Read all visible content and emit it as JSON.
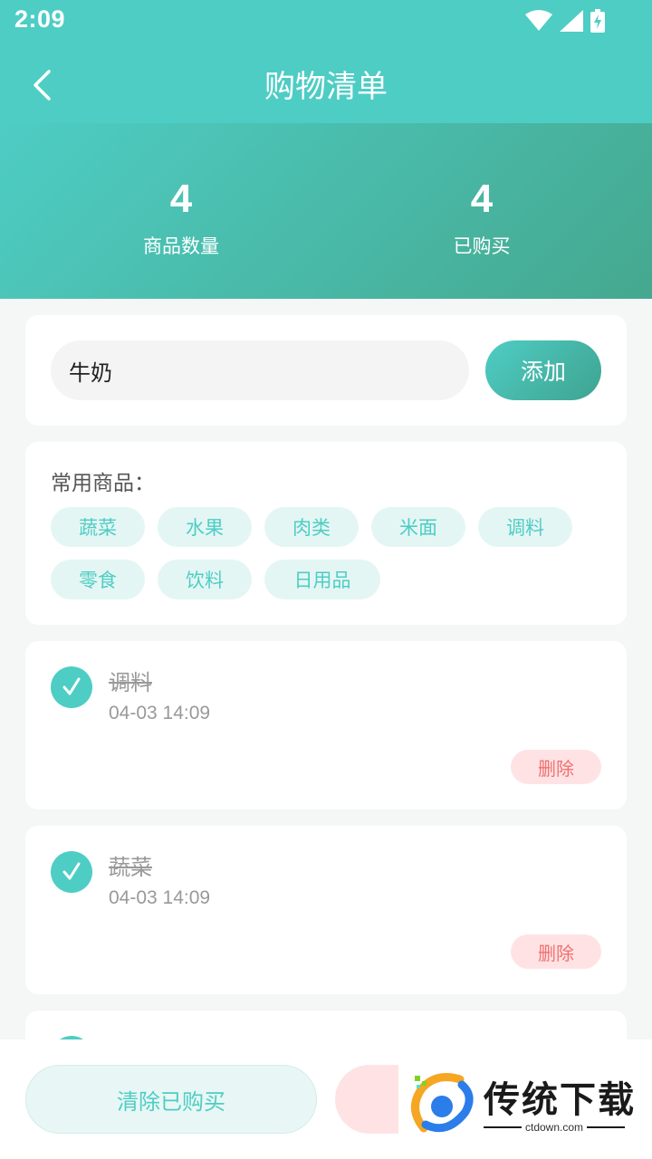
{
  "status": {
    "time": "2:09"
  },
  "nav": {
    "title": "购物清单"
  },
  "stats": [
    {
      "value": "4",
      "label": "商品数量"
    },
    {
      "value": "4",
      "label": "已购买"
    }
  ],
  "input": {
    "value": "牛奶",
    "add_label": "添加"
  },
  "common": {
    "title": "常用商品：",
    "tags": [
      "蔬菜",
      "水果",
      "肉类",
      "米面",
      "调料",
      "零食",
      "饮料",
      "日用品"
    ]
  },
  "items": [
    {
      "name": "调料",
      "time": "04-03 14:09",
      "delete_label": "删除"
    },
    {
      "name": "蔬菜",
      "time": "04-03 14:09",
      "delete_label": "删除"
    }
  ],
  "bottom": {
    "clear_label": "清除已购买"
  },
  "watermark": {
    "brand": "传统下载",
    "site": "ctdown.com"
  },
  "colors": {
    "accent": "#4ecdc4",
    "danger": "#f07070",
    "danger_bg": "#ffe3e4"
  }
}
